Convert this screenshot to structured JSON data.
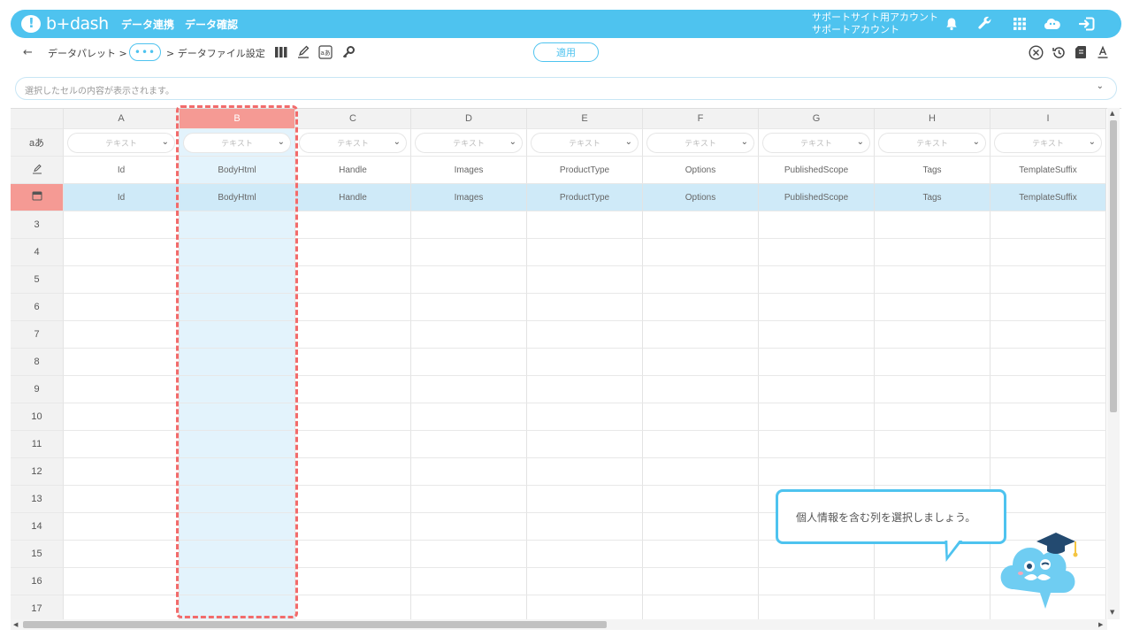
{
  "header": {
    "logo_text": "b+dash",
    "nav": [
      "データ連携",
      "データ確認"
    ],
    "account_line1": "サポートサイト用アカウント",
    "account_line2": "サポートアカウント",
    "icons": [
      "bell-icon",
      "wrench-icon",
      "apps-grid-icon",
      "cloud-mascot-icon",
      "logout-icon"
    ]
  },
  "subbar": {
    "back_label": "←",
    "crumb1": "データパレット >",
    "more_label": "•••",
    "crumb2": "> データファイル設定",
    "apply_label": "適用",
    "tools": [
      "columns-icon",
      "edit-icon",
      "text-convert-icon",
      "key-icon"
    ],
    "right_tools": [
      "close-circle-icon",
      "history-icon",
      "document-icon",
      "text-format-icon"
    ]
  },
  "cellbar": {
    "placeholder": "選択したセルの内容が表示されます。",
    "chevron": "⌄"
  },
  "grid": {
    "columns": [
      "A",
      "B",
      "C",
      "D",
      "E",
      "F",
      "G",
      "H",
      "I"
    ],
    "type_row_label": "aあ",
    "type_placeholder": "テキスト",
    "name_row": [
      "Id",
      "BodyHtml",
      "Handle",
      "Images",
      "ProductType",
      "Options",
      "PublishedScope",
      "Tags",
      "TemplateSuffix"
    ],
    "data_row": [
      "Id",
      "BodyHtml",
      "Handle",
      "Images",
      "ProductType",
      "Options",
      "PublishedScope",
      "Tags",
      "TemplateSuffix"
    ],
    "row_numbers": [
      "3",
      "4",
      "5",
      "6",
      "7",
      "8",
      "9",
      "10",
      "11",
      "12",
      "13",
      "14",
      "15",
      "16",
      "17"
    ],
    "selected_column": "B",
    "key_column": "A",
    "colors": {
      "accent": "#4ec3ef",
      "selected_header": "#f59a94",
      "selected_col": "#e3f3fc",
      "blue_row": "#cfeaf8",
      "dash": "#f26b6b"
    }
  },
  "tooltip": {
    "text": "個人情報を含む列を選択しましょう。"
  }
}
